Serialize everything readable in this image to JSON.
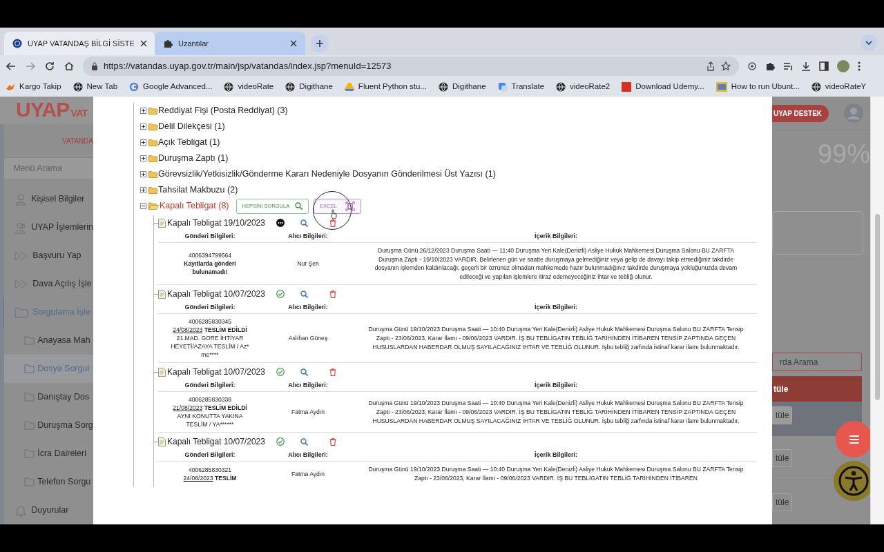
{
  "browser": {
    "tabs": [
      {
        "title": "UYAP VATANDAŞ BİLGİ SİSTE",
        "selected": true
      },
      {
        "title": "Uzantılar",
        "selected": false
      }
    ],
    "url": "https://vatandas.uyap.gov.tr/main/jsp/vatandas/index.jsp?menuId=12573",
    "bookmarks": [
      {
        "label": "Kargo Takip",
        "kind": "bird"
      },
      {
        "label": "New Tab",
        "kind": "globe"
      },
      {
        "label": "Google Advanced...",
        "kind": "google"
      },
      {
        "label": "videoRate",
        "kind": "globe"
      },
      {
        "label": "Digithane",
        "kind": "globe"
      },
      {
        "label": "Fluent Python stu...",
        "kind": "drive"
      },
      {
        "label": "Digithane",
        "kind": "globe"
      },
      {
        "label": "Translate",
        "kind": "translate"
      },
      {
        "label": "videoRate2",
        "kind": "globe"
      },
      {
        "label": "Download Udemy...",
        "kind": "square"
      },
      {
        "label": "How to run Ubunt...",
        "kind": "thumb"
      },
      {
        "label": "videoRateY",
        "kind": "globe"
      }
    ]
  },
  "background_page": {
    "logo": "UYAP",
    "logo_suffix": "VAT",
    "portal_label": "VATANDA",
    "menu_search": "Menü Arama",
    "menu": [
      {
        "label": "Kişisel Bilgiler",
        "kind": "person",
        "selected": false
      },
      {
        "label": "UYAP İşlemlerin",
        "kind": "people",
        "selected": false
      },
      {
        "label": "Başvuru Yap",
        "kind": "arrow",
        "selected": false
      },
      {
        "label": "Dava Açılış İşle",
        "kind": "arrow",
        "selected": false
      },
      {
        "label": "Sorgulama İşle",
        "kind": "folder",
        "selected": true,
        "children": [
          {
            "label": "Anayasa Mah",
            "selected": false
          },
          {
            "label": "Dosya Sorgul",
            "selected": true
          },
          {
            "label": "Danıştay Dos",
            "selected": false
          },
          {
            "label": "Duruşma Sorg",
            "selected": false
          },
          {
            "label": "İcra Daireleri",
            "selected": false
          },
          {
            "label": "Telefon Sorgu",
            "selected": false
          }
        ]
      },
      {
        "label": "Duyurular",
        "kind": "bell",
        "selected": false
      }
    ],
    "support_button": "UYAP DESTEK",
    "percent": "99%",
    "search_placeholder": "rda Arama",
    "buttons": [
      {
        "label": "tüle",
        "kind": "bar"
      },
      {
        "label": "tüle",
        "kind": "panel"
      },
      {
        "label": "tüle",
        "kind": "button"
      },
      {
        "label": "tüle",
        "kind": "button"
      }
    ]
  },
  "tree": [
    {
      "label": "Reddiyat Fişi (Posta Reddiyat) (3)",
      "expanded": false
    },
    {
      "label": "Delil Dilekçesi (1)",
      "expanded": false
    },
    {
      "label": "Açık Tebligat (1)",
      "expanded": false
    },
    {
      "label": "Duruşma Zaptı (1)",
      "expanded": false
    },
    {
      "label": "Görevsizlik/Yetkisizlik/Gönderme Kararı Nedeniyle Dosyanın Gönderilmesi Üst Yazısı (1)",
      "expanded": false
    },
    {
      "label": "Tahsilat Makbuzu (2)",
      "expanded": false
    },
    {
      "label": "Kapalı Tebligat (8)",
      "expanded": true,
      "query_all_button": "HEPSİNİ SORGULA",
      "excel_button": "EXCEL",
      "records": [
        {
          "title": "Kapalı Tebligat 19/10/2023",
          "delivered": false,
          "columns": [
            "Gönderi Bilgileri:",
            "Alıcı Bilgileri:",
            "İçerik Bilgileri:"
          ],
          "barcode": "4006394799564",
          "status": "Kayıtlarda gönderi bulunamadı!",
          "recipient": "Nur Şen",
          "content": "Duruşma Günü 26/12/2023 Duruşma Saati — 11:40 Duruşma Yeri Kale(Denizli) Asliye Hukuk Mahkemesi Duruşma Salonu BU ZARFTA Duruşma Zaptı - 19/10/2023 VARDIR. Belirlenen gün ve saatte duruşmaya gelmediğiniz veya gelip de davayı takip etmediğiniz takdirde dosyanın işlemden kaldırılacağı, geçerli bir özrünüz olmadan mahkemede hazır bulunmadığınız takdirde duruşmaya yokluğunuzda devam edileceği ve yapılan işlemlere itiraz edemeyeceğiniz ihtar ve tebliğ olunur."
        },
        {
          "title": "Kapalı Tebligat 10/07/2023",
          "delivered": true,
          "columns": [
            "Gönderi Bilgileri:",
            "Alıcı Bilgileri:",
            "İçerik Bilgileri:"
          ],
          "barcode": "4006285830345",
          "date": "24/08/2023",
          "status": "TESLİM EDİLDİ",
          "note": "21.MAD. GORE İHTİYAR HEYETİ/AZAYA TESLİM / Az* me****",
          "recipient": "Aslıhan Güneş",
          "content": "Duruşma Günü 19/10/2023 Duruşma Saati — 10:40 Duruşma Yeri Kale(Denizli) Asliye Hukuk Mahkemesi Duruşma Salonu BU ZARFTA Tensip Zaptı - 23/06/2023, Karar İlamı - 09/06/2023 VARDIR. İŞ BU TEBLİGATIN TEBLİĞ TARİHİNDEN İTİBAREN TENSİP ZAPTINDA GEÇEN HUSUSLARDAN HABERDAR OLMUŞ SAYILACAĞINIZ İHTAR VE TEBLİĞ OLUNUR. İşbu tebliğ zarfında istinaf karar ilamı bulunmaktadır."
        },
        {
          "title": "Kapalı Tebligat 10/07/2023",
          "delivered": true,
          "columns": [
            "Gönderi Bilgileri:",
            "Alıcı Bilgileri:",
            "İçerik Bilgileri:"
          ],
          "barcode": "4006285830338",
          "date": "21/08/2023",
          "status": "TESLİM EDİLDİ",
          "note": "AYNI KONUTTA YAKINA TESLİM / YA******",
          "recipient": "Fatma Aydın",
          "content": "Duruşma Günü 19/10/2023 Duruşma Saati — 10:40 Duruşma Yeri Kale(Denizli) Asliye Hukuk Mahkemesi Duruşma Salonu BU ZARFTA Tensip Zaptı - 23/06/2023, Karar İlamı - 09/06/2023 VARDIR. İŞ BU TEBLİGATIN TEBLİĞ TARİHİNDEN İTİBAREN TENSİP ZAPTINDA GEÇEN HUSUSLARDAN HABERDAR OLMUŞ SAYILACAĞINIZ İHTAR VE TEBLİĞ OLUNUR. İşbu tebliğ zarfında istinaf karar ilamı bulunmaktadır."
        },
        {
          "title": "Kapalı Tebligat 10/07/2023",
          "delivered": true,
          "columns": [
            "Gönderi Bilgileri:",
            "Alıcı Bilgileri:",
            "İçerik Bilgileri:"
          ],
          "barcode": "4006285830321",
          "date": "24/08/2023",
          "status": "TESLİM",
          "recipient": "Fatma Aydın",
          "content": "Duruşma Günü 19/10/2023 Duruşma Saati — 10:40 Duruşma Yeri Kale(Denizli) Asliye Hukuk Mahkemesi Duruşma Salonu BU ZARFTA Tensip Zaptı - 23/06/2023, Karar İlamı - 09/06/2023 VARDIR. İŞ BU TEBLİGATIN TEBLİĞ TARİHİNDEN İTİBAREN"
        }
      ]
    }
  ]
}
